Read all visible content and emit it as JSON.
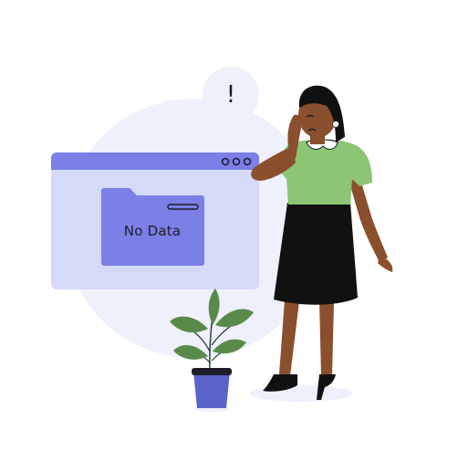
{
  "empty_state": {
    "folder_label": "No Data",
    "bubble_mark": "!"
  },
  "colors": {
    "backdrop_circle": "#eef0fb",
    "window_body": "#d4daf8",
    "window_titlebar": "#7b7fe6",
    "folder": "#7b7fe6",
    "pot": "#5a63c9",
    "leaf": "#5a8a4a",
    "skirt": "#111111",
    "top": "#8cc574",
    "skin": "#8a4f2d",
    "hair": "#111111"
  },
  "icons": [
    "window-controls-icon",
    "folder-icon",
    "exclamation-bubble-icon",
    "potted-plant-icon",
    "woman-illustration"
  ]
}
